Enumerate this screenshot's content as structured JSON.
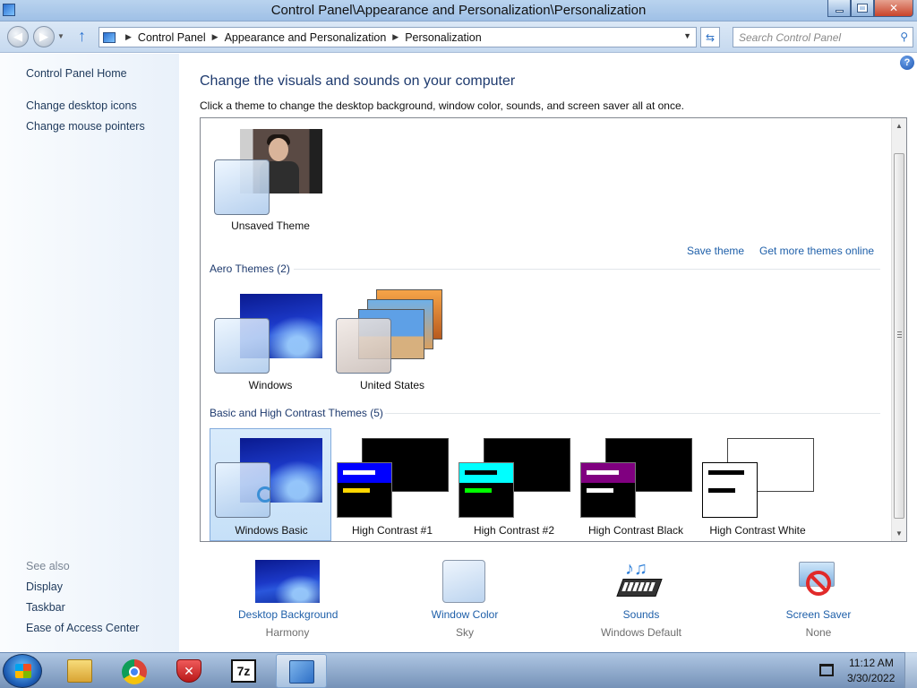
{
  "window": {
    "title": "Control Panel\\Appearance and Personalization\\Personalization"
  },
  "address": {
    "crumbs": [
      "Control Panel",
      "Appearance and Personalization",
      "Personalization"
    ],
    "search_placeholder": "Search Control Panel"
  },
  "sidebar": {
    "home": "Control Panel Home",
    "links": [
      "Change desktop icons",
      "Change mouse pointers"
    ],
    "see_also_label": "See also",
    "see_also": [
      "Display",
      "Taskbar",
      "Ease of Access Center"
    ]
  },
  "main": {
    "title": "Change the visuals and sounds on your computer",
    "subtitle": "Click a theme to change the desktop background, window color, sounds, and screen saver all at once.",
    "save_theme": "Save theme",
    "get_more": "Get more themes online",
    "my_themes": [
      {
        "label": "Unsaved Theme"
      }
    ],
    "aero_header": "Aero Themes (2)",
    "aero_themes": [
      {
        "label": "Windows"
      },
      {
        "label": "United States"
      }
    ],
    "basic_header": "Basic and High Contrast Themes (5)",
    "basic_themes": [
      {
        "label": "Windows Basic"
      },
      {
        "label": "High Contrast #1"
      },
      {
        "label": "High Contrast #2"
      },
      {
        "label": "High Contrast Black"
      },
      {
        "label": "High Contrast White"
      }
    ],
    "selected_theme": "Windows Basic"
  },
  "settings": [
    {
      "label": "Desktop Background",
      "value": "Harmony",
      "icon": "desktop-background-icon"
    },
    {
      "label": "Window Color",
      "value": "Sky",
      "icon": "window-color-icon"
    },
    {
      "label": "Sounds",
      "value": "Windows Default",
      "icon": "sounds-icon"
    },
    {
      "label": "Screen Saver",
      "value": "None",
      "icon": "screen-saver-icon"
    }
  ],
  "taskbar": {
    "apps": [
      "file-explorer-icon",
      "chrome-icon",
      "security-shield-icon",
      "7zip-icon",
      "control-panel-icon"
    ],
    "time": "11:12 AM",
    "date": "3/30/2022"
  },
  "colors": {
    "link": "#1e5fa9",
    "heading": "#1e3a6e",
    "hc1_bar1": "#0000ff",
    "hc1_bar2": "#ffd700",
    "hc2_bar1": "#00ffff",
    "hc2_bar2": "#00ff00",
    "hcb_bar1": "#800080"
  }
}
